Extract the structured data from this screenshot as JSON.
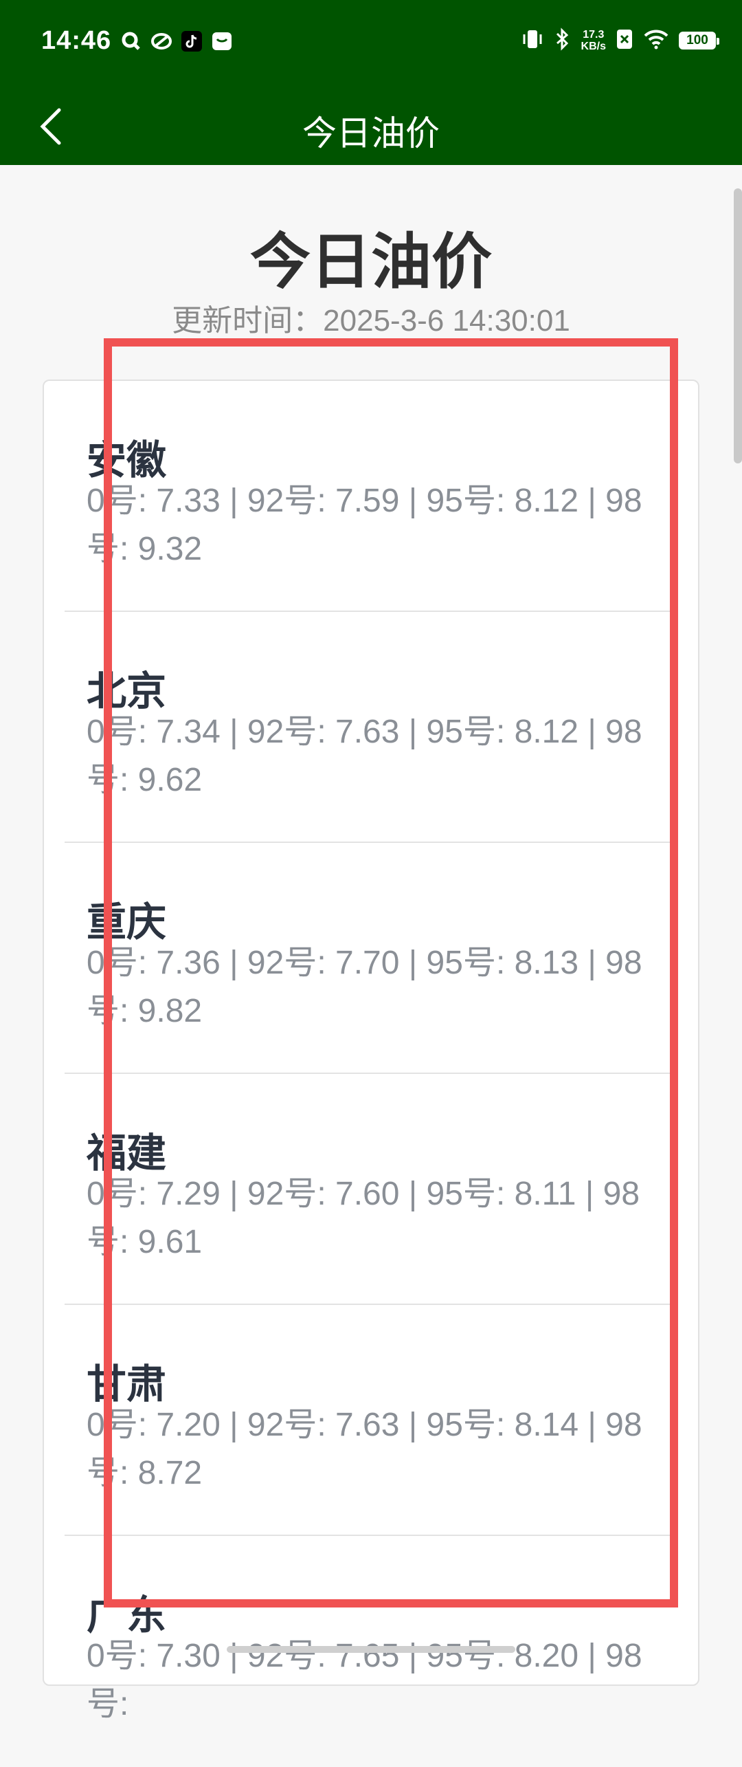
{
  "status": {
    "time": "14:46",
    "net_speed_value": "17.3",
    "net_speed_unit": "KB/s",
    "battery": "100"
  },
  "appbar": {
    "title": "今日油价"
  },
  "page": {
    "title": "今日油价",
    "update_text": "更新时间：2025-3-6 14:30:01"
  },
  "provinces": [
    {
      "name": "安徽",
      "prices": "0号: 7.33 | 92号: 7.59 | 95号: 8.12 | 98号: 9.32"
    },
    {
      "name": "北京",
      "prices": "0号: 7.34 | 92号: 7.63 | 95号: 8.12 | 98号: 9.62"
    },
    {
      "name": "重庆",
      "prices": "0号: 7.36 | 92号: 7.70 | 95号: 8.13 | 98号: 9.82"
    },
    {
      "name": "福建",
      "prices": "0号: 7.29 | 92号: 7.60 | 95号: 8.11 | 98号: 9.61"
    },
    {
      "name": "甘肃",
      "prices": "0号: 7.20 | 92号: 7.63 | 95号: 8.14 | 98号: 8.72"
    },
    {
      "name": "广东",
      "prices": "0号: 7.30 | 92号: 7.65 | 95号: 8.20 | 98号:"
    }
  ],
  "colors": {
    "appbar": "#005400",
    "highlight": "#f05252"
  }
}
